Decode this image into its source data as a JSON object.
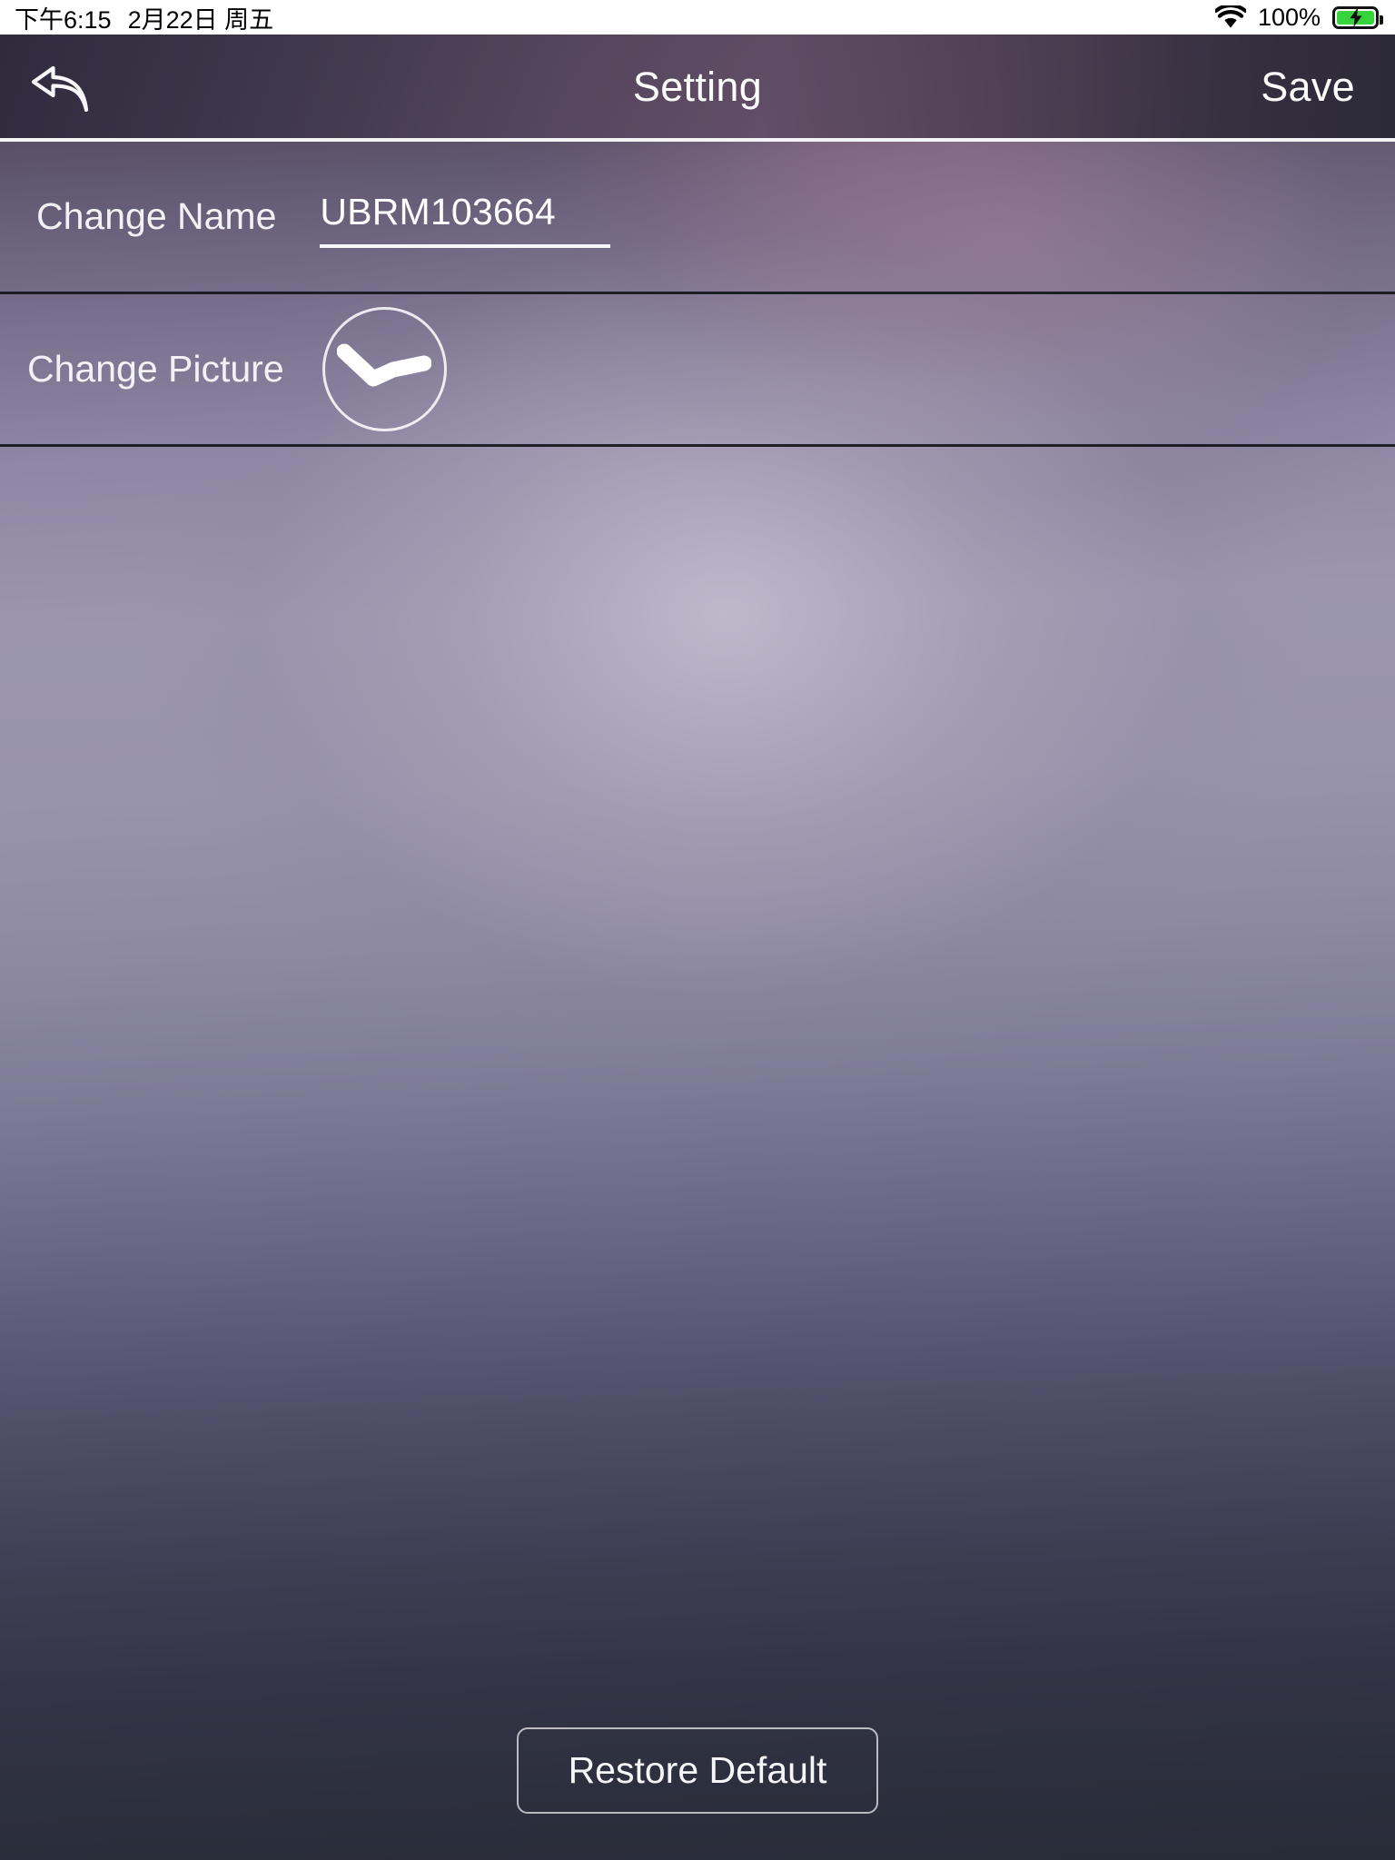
{
  "statusbar": {
    "time": "下午6:15",
    "date": "2月22日 周五",
    "wifi_icon": "wifi-icon",
    "battery_percent": "100%",
    "battery_icon": "battery-charging-icon",
    "battery_level": 100
  },
  "navbar": {
    "back_icon": "back-arrow-icon",
    "title": "Setting",
    "save_label": "Save"
  },
  "rows": {
    "change_name": {
      "label": "Change Name",
      "value": "UBRM103664",
      "placeholder": "UBRM103664"
    },
    "change_picture": {
      "label": "Change Picture",
      "avatar_icon": "wave-profile-icon"
    }
  },
  "footer": {
    "restore_label": "Restore Default"
  },
  "colors": {
    "statusbar_bg": "#ffffff",
    "statusbar_text": "#000000",
    "battery_green": "#37d33c",
    "navbar_text": "#fdfdfe",
    "row_text": "#f2f1f5",
    "divider": "#15161d",
    "nav_separator": "#f4f3f6",
    "background_top": "#3b3546",
    "background_mid": "#9b95ae",
    "background_bottom": "#282b38",
    "button_border": "#e2e2e8"
  }
}
